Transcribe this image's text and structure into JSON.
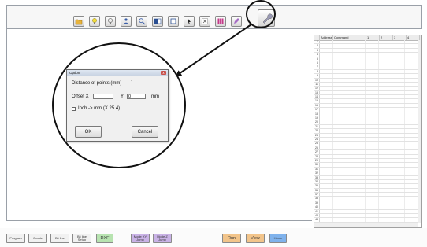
{
  "toolbar": {
    "buttons": [
      {
        "icon": "folder-icon",
        "color": "#e7b33c"
      },
      {
        "icon": "lightbulb-icon",
        "color": "#e8d23a"
      },
      {
        "icon": "bulb-outline-icon",
        "color": "#555555"
      },
      {
        "icon": "person-icon",
        "color": "#3a5ea8"
      },
      {
        "icon": "zoom-icon",
        "color": "#3a5ea8"
      },
      {
        "icon": "window-icon",
        "color": "#2a4f92"
      },
      {
        "icon": "square-icon",
        "color": "#2a4f92"
      },
      {
        "icon": "cursor-icon",
        "color": "#222222"
      },
      {
        "icon": "close-x-icon",
        "color": "#666666"
      },
      {
        "icon": "grid-icon",
        "color": "#c43b8a"
      },
      {
        "icon": "pen-icon",
        "color": "#a46bc4"
      },
      {
        "icon": "wrench-icon",
        "color": "#7a7a9a"
      }
    ]
  },
  "grid": {
    "columns": [
      "Address",
      "Command",
      "1",
      "2",
      "3",
      "4"
    ],
    "row_numbers": [
      "1",
      "2",
      "3",
      "4",
      "5",
      "6",
      "7",
      "8",
      "9",
      "10",
      "11",
      "12",
      "13",
      "14",
      "15",
      "16",
      "17",
      "18",
      "19",
      "20",
      "21",
      "22",
      "23",
      "24",
      "25",
      "26",
      "27",
      "28",
      "29",
      "30",
      "31",
      "32",
      "33",
      "34",
      "35",
      "36",
      "37",
      "38",
      "39",
      "40",
      "41",
      "42",
      "43"
    ]
  },
  "dialog": {
    "title": "Option",
    "close": "x",
    "distance_label": "Distance of points (mm)",
    "distance_value": "1",
    "offset_x_label": "Offset X",
    "offset_x_value": "",
    "y_label": "Y",
    "y_value": "0",
    "mm_label": "mm",
    "inch_label": "Inch -> mm (X 25.4)",
    "ok_label": "OK",
    "cancel_label": "Cancel"
  },
  "bottom": {
    "buttons": [
      {
        "label": "Program",
        "color": "#f1f1f1"
      },
      {
        "label": "Create",
        "color": "#f1f1f1"
      },
      {
        "label": "Bit line",
        "color": "#f1f1f1"
      },
      {
        "label": "Bit line Setup",
        "color": "#f1f1f1"
      },
      {
        "label": "DXF",
        "color": "#b7e3b0"
      },
      {
        "label": "Mode XY Jump",
        "color": "#c9b2e6"
      },
      {
        "label": "Mode Z Jump",
        "color": "#c9b2e6"
      },
      {
        "label": "Run",
        "color": "#f2c48a"
      },
      {
        "label": "View",
        "color": "#f2c48a"
      },
      {
        "label": "Home",
        "color": "#7fb2ec"
      }
    ]
  }
}
